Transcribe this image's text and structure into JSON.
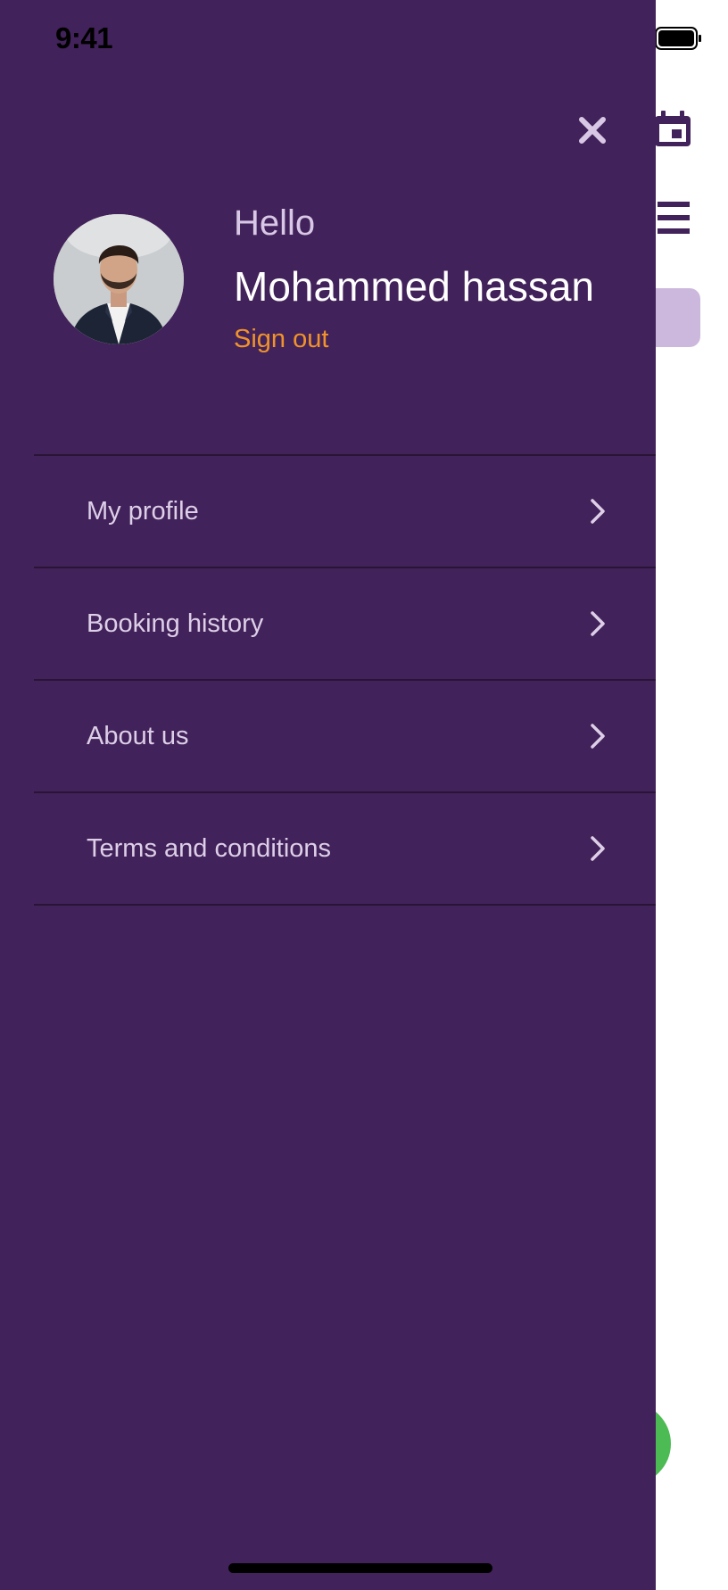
{
  "status_bar": {
    "time": "9:41"
  },
  "drawer": {
    "greeting": "Hello",
    "user_name": "Mohammed hassan",
    "sign_out_label": "Sign out",
    "menu_items": [
      {
        "label": "My profile",
        "icon": "chevron-right-icon"
      },
      {
        "label": "Booking history",
        "icon": "chevron-right-icon"
      },
      {
        "label": "About us",
        "icon": "chevron-right-icon"
      },
      {
        "label": "Terms and conditions",
        "icon": "chevron-right-icon"
      }
    ]
  },
  "background_app": {
    "icons": [
      "calendar-icon",
      "list-icon"
    ]
  },
  "colors": {
    "drawer_background": "#42225a",
    "accent_orange": "#f0932b",
    "greeting_text": "#d8c8e6",
    "pill_background": "#cdb8dd",
    "fab_green": "#4cbb53"
  }
}
